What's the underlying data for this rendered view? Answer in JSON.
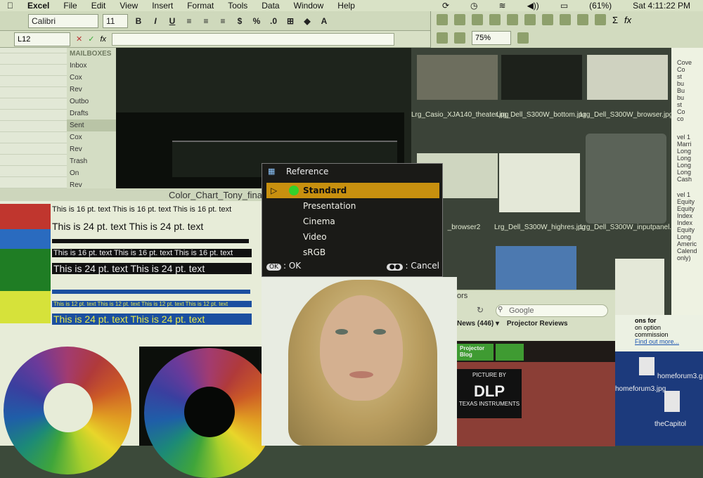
{
  "menubar": {
    "app": "Excel",
    "items": [
      "File",
      "Edit",
      "View",
      "Insert",
      "Format",
      "Tools",
      "Data",
      "Window",
      "Help"
    ],
    "battery": "(61%)",
    "clock": "Sat 4:11:22 PM"
  },
  "toolbar": {
    "font": "Calibri",
    "size": "11",
    "bold": "B",
    "italic": "I",
    "underline": "U",
    "currency": "$",
    "percent": "%",
    "zoom": "75%",
    "sum": "Σ",
    "fx": "fx"
  },
  "formula": {
    "cell_ref": "L12",
    "fx": "fx"
  },
  "mail": {
    "header": "MAILBOXES",
    "items": [
      "Inbox",
      "Cox",
      "Rev",
      "Outbo",
      "Drafts",
      "Sent",
      "Cox",
      "Rev",
      "Trash",
      "On",
      "Rev"
    ]
  },
  "finder": {
    "thumbs": [
      "Lrg_Casio_XJA140_theater.jpg",
      "Lrg_Dell_S300W_bottom.jpg",
      "Lrg_Dell_S300W_browser.jpg",
      "_browser2",
      "Lrg_Dell_S300W_highres.jpg",
      "Lrg_Dell_S300W_inputpanel.jpg"
    ]
  },
  "rightdoc": {
    "lines": [
      "Cove",
      "Co",
      "st",
      "bu",
      "Bu",
      "bu",
      "st",
      "Co",
      "co",
      "vel 1",
      "Marri",
      "Long",
      "Long",
      "Long",
      "Long",
      "Cash",
      "vel 1",
      "Equity",
      "Equity",
      "Index",
      "Index",
      "Equity",
      "Long",
      "Americ",
      "Calend",
      "only)"
    ]
  },
  "sheet": {
    "title": "Color_Chart_Tony_final_2",
    "rows": [
      "This is 16 pt. text   This is 16 pt. text   This is 16 pt. text",
      "This is 24 pt. text   This is 24 pt. text",
      "This is 16 pt. text   This is 16 pt. text   This is 16 pt. text",
      "This is 24 pt. text   This is 24 pt. text",
      "This is 12 pt. text   This is 12 pt. text   This is 12 pt. text   This is 12 pt. text",
      "This is 24 pt. text   This is 24 pt. text"
    ]
  },
  "osd": {
    "title": "Reference",
    "items": [
      "Standard",
      "Presentation",
      "Cinema",
      "Video",
      "sRGB"
    ],
    "selected": "Standard",
    "ok_key": "OK",
    "ok_label": ": OK",
    "cancel_key": "●●",
    "cancel_label": ": Cancel"
  },
  "browser": {
    "tab": "ors",
    "search_placeholder": "Google",
    "bookmark_1": "News (446) ▾",
    "bookmark_2": "Projector Reviews",
    "blog_badge": "Projector Blog",
    "dlp_top": "PICTURE BY",
    "dlp_logo": "DLP",
    "dlp_sub": "TEXAS INSTRUMENTS"
  },
  "desktop": {
    "learn_title": "ons for",
    "learn_body": "on option commission",
    "link": "Find out more...",
    "file_1": "homeforum3.gif",
    "file_2": "homeforum3.jpg",
    "file_3": "theCapitol"
  }
}
